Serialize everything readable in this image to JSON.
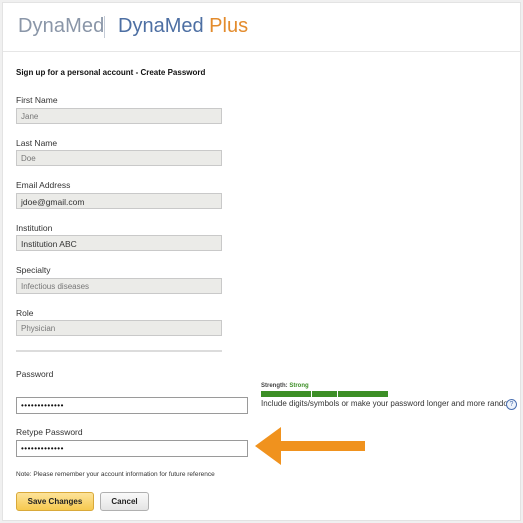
{
  "brand": {
    "name1": "DynaMed",
    "name2_main": "DynaMed",
    "name2_plus": "Plus"
  },
  "form": {
    "heading": "Sign up for a personal account - Create Password",
    "first_name": {
      "label": "First Name",
      "value": "Jane"
    },
    "last_name": {
      "label": "Last Name",
      "value": "Doe"
    },
    "email": {
      "label": "Email Address",
      "value": "jdoe@gmail.com"
    },
    "institution": {
      "label": "Institution",
      "value": "Institution ABC"
    },
    "specialty": {
      "label": "Specialty",
      "value": "Infectious diseases"
    },
    "role": {
      "label": "Role",
      "value": "Physician"
    },
    "password": {
      "label": "Password",
      "value": "•••••••••••••"
    },
    "retype_password": {
      "label": "Retype Password",
      "value": "•••••••••••••"
    },
    "strength": {
      "label": "Strength:",
      "value": "Strong",
      "segments_filled": 3,
      "segments_total": 3
    },
    "hint": "Include digits/symbols or make your password longer and more random.",
    "help_icon": "?",
    "note": "Note: Please remember your account information for future reference",
    "save_label": "Save Changes",
    "cancel_label": "Cancel"
  },
  "colors": {
    "strength_green": "#3c8f26",
    "arrow_orange": "#f0921e",
    "save_button": "#f6c94f",
    "brand_blue": "#4d6fa3"
  },
  "icons": {
    "help": "question-circle-icon",
    "annotation": "left-arrow-icon"
  }
}
